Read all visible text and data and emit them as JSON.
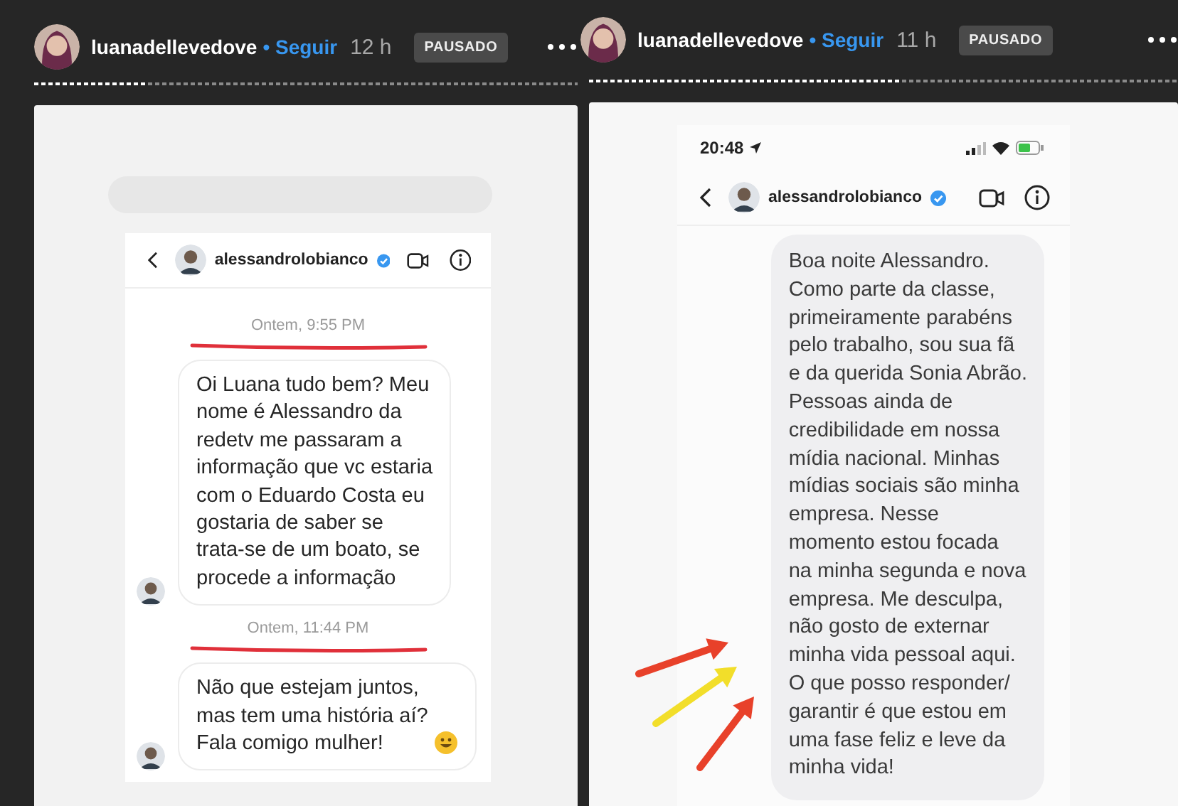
{
  "stories": [
    {
      "username": "luanadellevedove",
      "follow": "• Seguir",
      "time": "12 h",
      "badge": "PAUSADO",
      "level": 0.21,
      "chat": {
        "contact": "alessandrolobianco",
        "verified": true,
        "blur_strip": true,
        "messages": [
          {
            "kind": "timestamp",
            "text": "Ontem, 9:55 PM",
            "underlined": true
          },
          {
            "kind": "received",
            "text": "Oi Luana tudo bem? Meu\nnome é Alessandro da\nredetv me passaram a\ninformação que vc estaria\ncom o Eduardo Costa eu\ngostaria de saber se\ntrata-se de um boato, se\nprocede a informação",
            "emoji": false
          },
          {
            "kind": "timestamp",
            "text": "Ontem, 11:44 PM",
            "underlined": true
          },
          {
            "kind": "received",
            "text": "Não que estejam juntos,\nmas tem uma história aí?\nFala comigo mulher!",
            "emoji": true
          }
        ]
      }
    },
    {
      "username": "luanadellevedove",
      "follow": "• Seguir",
      "time": "11 h",
      "badge": "PAUSADO",
      "level": 0.53,
      "chat": {
        "status_bar": {
          "time": "20:48"
        },
        "contact": "alessandrolobianco",
        "verified": true,
        "arrows": true,
        "messages": [
          {
            "kind": "sent",
            "text": "Boa noite Alessandro.\nComo parte da classe,\nprimeiramente parabéns\npelo trabalho, sou sua fã\ne da querida Sonia Abrão.\nPessoas ainda de\ncredibilidade em nossa\nmídia nacional. Minhas\nmídias sociais são minha\nempresa. Nesse\nmomento estou focada\nna minha segunda e nova\nempresa. Me desculpa,\nnão gosto de externar\nminha vida pessoal aqui.\nO que posso responder/\ngarantir é que estou em\numa fase feliz e leve da\nminha vida!",
            "emoji": false
          }
        ]
      }
    }
  ]
}
